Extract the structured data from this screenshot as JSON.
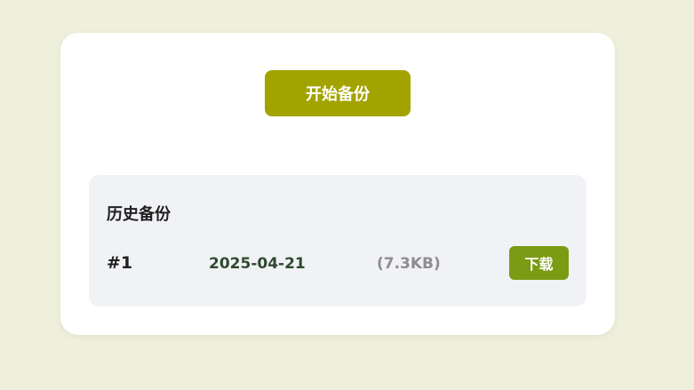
{
  "actions": {
    "start_backup_label": "开始备份"
  },
  "history": {
    "title": "历史备份",
    "items": [
      {
        "index": "#1",
        "date": "2025-04-21",
        "size": "(7.3KB)",
        "download_label": "下载"
      }
    ]
  },
  "colors": {
    "page_background": "#eef0dc",
    "primary_button": "#a3a300",
    "download_button": "#7a9c14"
  }
}
